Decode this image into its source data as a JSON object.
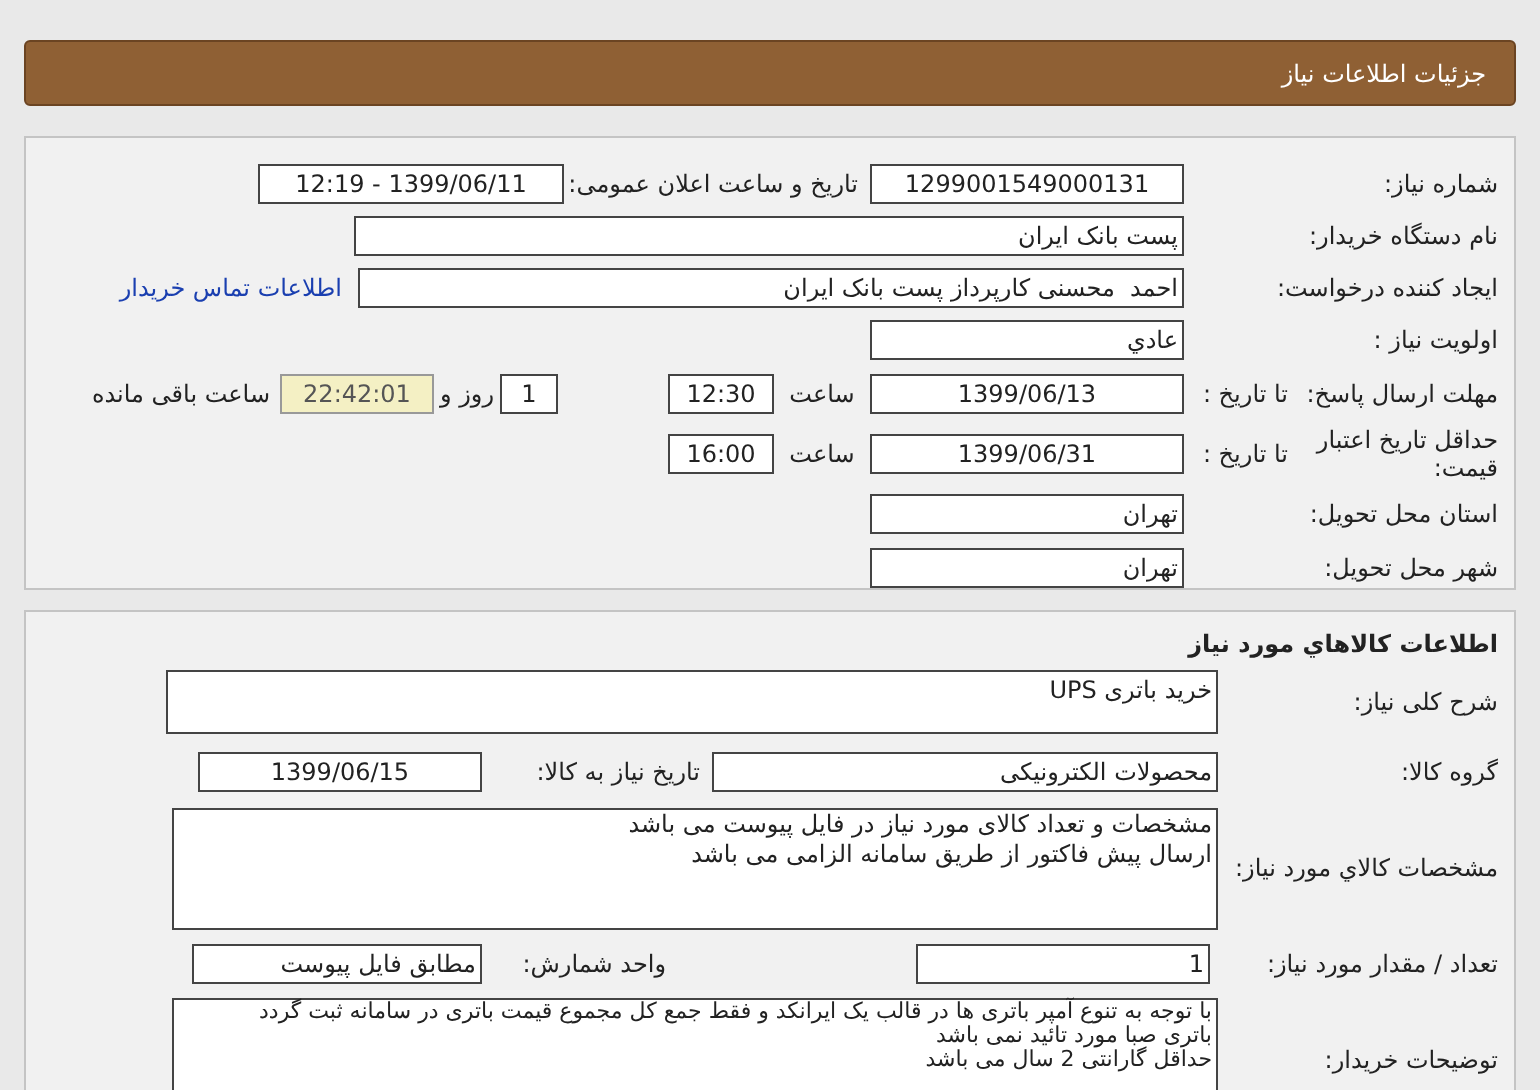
{
  "header": {
    "title": "جزئیات اطلاعات نیاز"
  },
  "details": {
    "need_number": {
      "label": "شماره نیاز:",
      "value": "1299001549000131"
    },
    "announce": {
      "label": "تاریخ و ساعت اعلان عمومی:",
      "value": "1399/06/11 - 12:19"
    },
    "buyer_org": {
      "label": "نام دستگاه خریدار:",
      "value": "پست بانک ایران"
    },
    "requester": {
      "label": "ایجاد کننده درخواست:",
      "value": "احمد  محسنی کارپرداز پست بانک ایران",
      "link": "اطلاعات تماس خریدار"
    },
    "priority": {
      "label": "اولویت نیاز :",
      "value": "عادي"
    },
    "reply_deadline": {
      "label": "مهلت ارسال پاسخ:",
      "to_date_label": "تا تاریخ :",
      "date": "1399/06/13",
      "time_label": "ساعت",
      "time": "12:30",
      "days": "1",
      "days_label": "روز و",
      "remaining": "22:42:01",
      "remaining_label": "ساعت باقی مانده"
    },
    "price_validity": {
      "label": "حداقل تاریخ اعتبار قیمت:",
      "to_date_label": "تا تاریخ :",
      "date": "1399/06/31",
      "time_label": "ساعت",
      "time": "16:00"
    },
    "province": {
      "label": "استان محل تحویل:",
      "value": "تهران"
    },
    "city": {
      "label": "شهر محل تحویل:",
      "value": "تهران"
    }
  },
  "goods": {
    "title": "اطلاعات کالاهاي مورد نیاز",
    "summary": {
      "label": "شرح کلی نیاز:",
      "value": "خرید باتری UPS"
    },
    "group": {
      "label": "گروه کالا:",
      "value": "محصولات الکترونیکی"
    },
    "need_date": {
      "label": "تاریخ نیاز به کالا:",
      "value": "1399/06/15"
    },
    "specs": {
      "label": "مشخصات کالاي مورد نیاز:",
      "lines": [
        "مشخصات و تعداد کالای مورد نیاز در فایل پیوست می باشد",
        "ارسال پیش فاکتور از طریق سامانه الزامی می باشد"
      ]
    },
    "quantity": {
      "label": "تعداد / مقدار مورد نیاز:",
      "value": "1"
    },
    "unit": {
      "label": "واحد شمارش:",
      "value": "مطابق فایل پیوست"
    },
    "buyer_notes": {
      "label": "توضیحات خریدار:",
      "lines": [
        "با توجه به تنوع آمپر باتری ها در قالب یک ایرانکد و فقط جمع کل مجموع قیمت باتری در سامانه ثبت گردد",
        "باتری صبا مورد تائید نمی باشد",
        "حداقل گارانتی 2 سال می باشد"
      ]
    }
  }
}
